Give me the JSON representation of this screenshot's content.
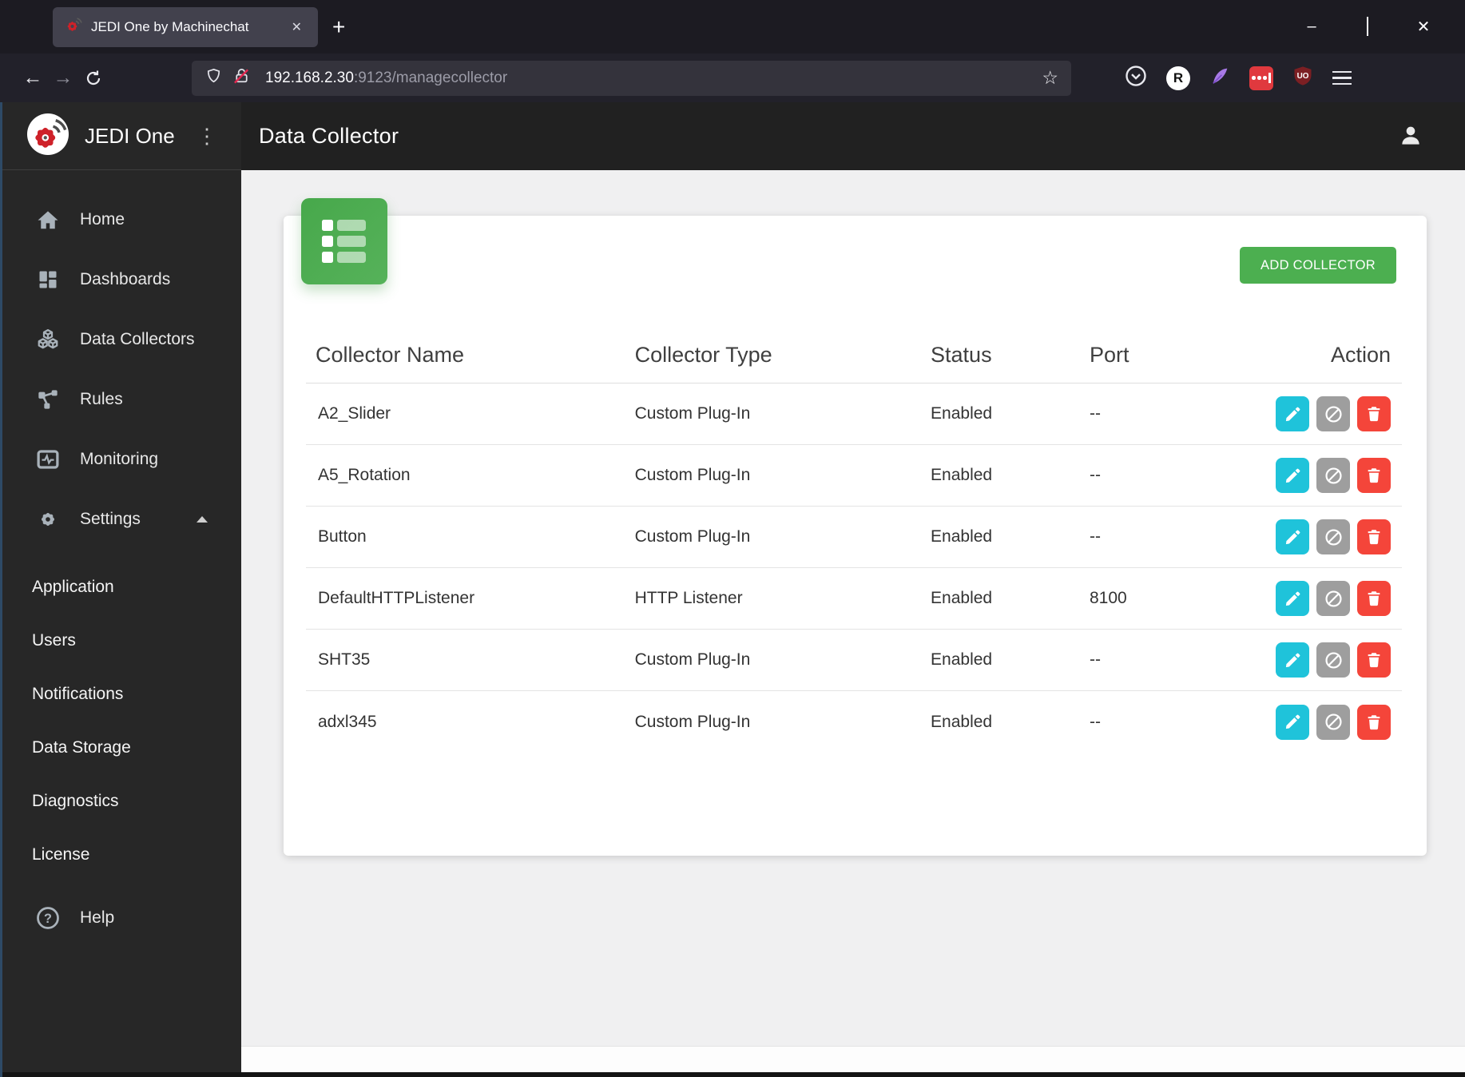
{
  "browser": {
    "tab_title": "JEDI One by Machinechat",
    "url": {
      "host": "192.168.2.30",
      "rest": ":9123/managecollector"
    },
    "icons": {
      "back": "←",
      "forward": "→",
      "close_tab": "✕",
      "new_tab": "+",
      "minimize": "–",
      "close_window": "✕",
      "star": "☆",
      "kebab": "⋮",
      "r_badge": "R",
      "uo_badge": "UO"
    }
  },
  "sidebar": {
    "brand": "JEDI One",
    "items": [
      {
        "label": "Home"
      },
      {
        "label": "Dashboards"
      },
      {
        "label": "Data Collectors"
      },
      {
        "label": "Rules"
      },
      {
        "label": "Monitoring"
      },
      {
        "label": "Settings"
      }
    ],
    "sub_items": [
      {
        "label": "Application"
      },
      {
        "label": "Users"
      },
      {
        "label": "Notifications"
      },
      {
        "label": "Data Storage"
      },
      {
        "label": "Diagnostics"
      },
      {
        "label": "License"
      }
    ],
    "help_label": "Help",
    "help_mark": "?"
  },
  "header": {
    "title": "Data Collector"
  },
  "collectors": {
    "add_button": "ADD COLLECTOR",
    "columns": {
      "name": "Collector Name",
      "type": "Collector Type",
      "status": "Status",
      "port": "Port",
      "action": "Action"
    },
    "rows": [
      {
        "name": "A2_Slider",
        "type": "Custom Plug-In",
        "status": "Enabled",
        "port": "--"
      },
      {
        "name": "A5_Rotation",
        "type": "Custom Plug-In",
        "status": "Enabled",
        "port": "--"
      },
      {
        "name": "Button",
        "type": "Custom Plug-In",
        "status": "Enabled",
        "port": "--"
      },
      {
        "name": "DefaultHTTPListener",
        "type": "HTTP Listener",
        "status": "Enabled",
        "port": "8100"
      },
      {
        "name": "SHT35",
        "type": "Custom Plug-In",
        "status": "Enabled",
        "port": "--"
      },
      {
        "name": "adxl345",
        "type": "Custom Plug-In",
        "status": "Enabled",
        "port": "--"
      }
    ]
  },
  "colors": {
    "accent_green": "#4caf50",
    "action_edit": "#1fc3da",
    "action_disable": "#9e9e9e",
    "action_delete": "#f4453a",
    "brand_red": "#ce2129",
    "header_dark": "#212121"
  }
}
